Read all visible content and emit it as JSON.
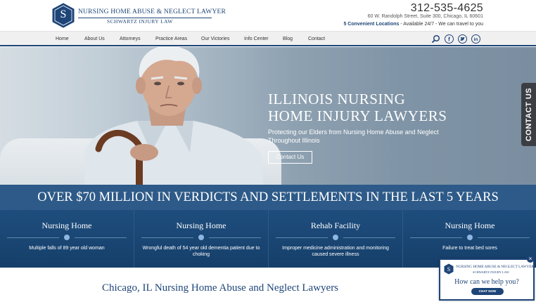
{
  "header": {
    "logo_title": "Nursing Home Abuse & Neglect Lawyer",
    "logo_subtitle": "Schwartz Injury Law",
    "logo_letter": "S",
    "phone": "312-535-4625",
    "address": "60 W. Randolph Street, Suite 300, Chicago, IL 60601",
    "locations_link": "5 Convenient Locations",
    "locations_rest": " - Available 24/7 - We can travel to you"
  },
  "nav": {
    "items": [
      "Home",
      "About Us",
      "Attorneys",
      "Practice Areas",
      "Our Victories",
      "Info Center",
      "Blog",
      "Contact"
    ]
  },
  "hero": {
    "title_line1": "ILLINOIS NURSING",
    "title_line2": "HOME INJURY LAWYERS",
    "subtitle": "Protecting our Elders from Nursing Home Abuse and Neglect Throughout Illinois",
    "button_label": "Contact Us",
    "contact_tab": "CONTACT US"
  },
  "banner": {
    "text": "OVER $70 MILLION IN VERDICTS AND SETTLEMENTS IN THE LAST 5 YEARS"
  },
  "stats": [
    {
      "title": "Nursing Home",
      "desc": "Multiple falls of 89 year old woman"
    },
    {
      "title": "Nursing Home",
      "desc": "Wrongful death of 54 year old dementia patient due to choking"
    },
    {
      "title": "Rehab Facility",
      "desc": "Improper medicine administration and monitoring caused severe illness"
    },
    {
      "title": "Nursing Home",
      "desc": "Failure to treat bed sores"
    }
  ],
  "bottom": {
    "title": "Chicago, IL Nursing Home Abuse and Neglect Lawyers"
  },
  "chat": {
    "brand": "Nursing Home Abuse & Neglect Lawyer",
    "brand_sub": "Schwartz Injury Law",
    "question": "How can we help you?",
    "button": "CHAT NOW",
    "close": "×"
  },
  "colors": {
    "brand_navy": "#1e4578",
    "banner": "#2d5a88",
    "stats_bg": "#1e4d7d"
  },
  "icons": [
    "search-icon",
    "facebook-icon",
    "twitter-icon",
    "linkedin-icon"
  ]
}
